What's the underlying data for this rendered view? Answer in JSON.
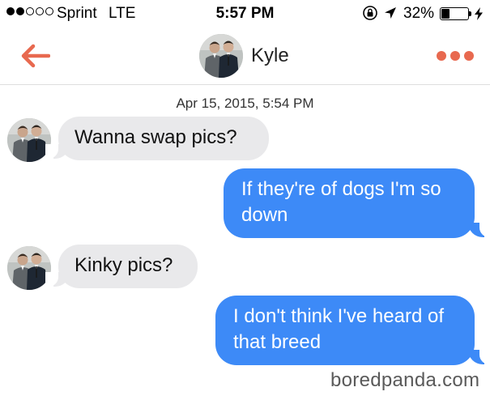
{
  "status_bar": {
    "carrier": "Sprint",
    "network": "LTE",
    "time": "5:57 PM",
    "battery_percent": "32%",
    "battery_level": 0.32,
    "signal_bars_filled": 2,
    "signal_bars_total": 5,
    "icons": [
      "rotation-lock-icon",
      "location-arrow-icon",
      "battery-icon",
      "charging-bolt-icon"
    ]
  },
  "header": {
    "contact_name": "Kyle",
    "icons": [
      "back-arrow-icon",
      "avatar",
      "more-options-icon"
    ],
    "accent_color": "#e8694f"
  },
  "thread": {
    "timestamp": "Apr 15, 2015, 5:54 PM",
    "messages": [
      {
        "direction": "incoming",
        "text": "Wanna swap pics?"
      },
      {
        "direction": "outgoing",
        "lines": [
          "If they're of dogs I'm so",
          "down"
        ]
      },
      {
        "direction": "incoming",
        "text": "Kinky pics?"
      },
      {
        "direction": "outgoing",
        "lines": [
          "I don't think I've heard of",
          "that breed"
        ]
      }
    ],
    "incoming_color": "#e9e9eb",
    "outgoing_color": "#3d8af7"
  },
  "watermark": "boredpanda.com"
}
